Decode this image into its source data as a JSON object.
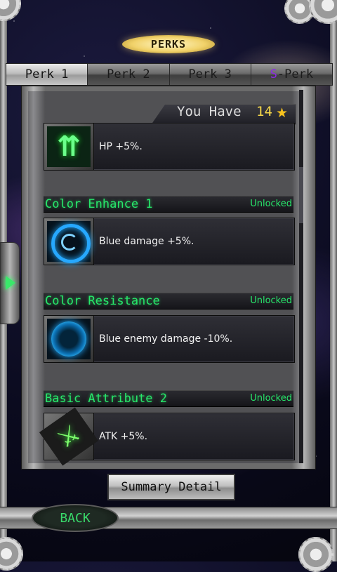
{
  "header": {
    "title": "PERKS"
  },
  "tabs": [
    {
      "label": "Perk 1",
      "active": true
    },
    {
      "label": "Perk 2",
      "active": false
    },
    {
      "label": "Perk 3",
      "active": false
    },
    {
      "label_prefix": "S",
      "label_suffix": "-Perk",
      "active": false
    }
  ],
  "currency": {
    "label": "You Have",
    "value": "14",
    "icon": "star-icon"
  },
  "perks": {
    "card0": {
      "desc": "HP +5%.",
      "icon": "hp-up-arrows-icon"
    },
    "sec1": {
      "title": "Color Enhance 1",
      "status": "Unlocked"
    },
    "card1": {
      "desc": "Blue damage +5%.",
      "icon": "blue-ring-icon"
    },
    "sec2": {
      "title": "Color Resistance",
      "status": "Unlocked"
    },
    "card2": {
      "desc": "Blue enemy damage -10%.",
      "icon": "blue-orb-icon"
    },
    "sec3": {
      "title": "Basic Attribute 2",
      "status": "Unlocked"
    },
    "card3": {
      "desc": "ATK +5%.",
      "icon": "sword-icon"
    }
  },
  "buttons": {
    "summary": "Summary Detail",
    "back": "BACK"
  },
  "colors": {
    "accent_green": "#27e86b",
    "star_gold": "#f6c21e",
    "s_purple": "#8b2be2"
  }
}
